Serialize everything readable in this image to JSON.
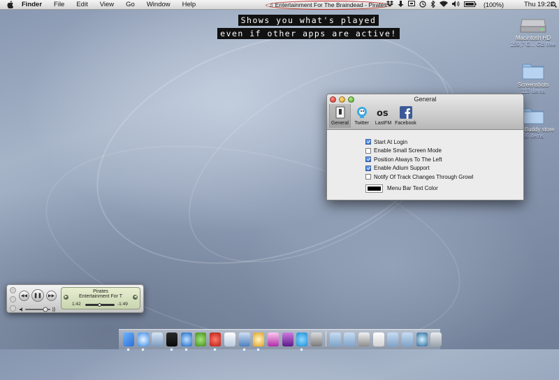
{
  "menubar": {
    "app_name": "Finder",
    "items": [
      "File",
      "Edit",
      "View",
      "Go",
      "Window",
      "Help"
    ],
    "now_playing": "♫ Entertainment For The Braindead - Pirates",
    "battery": "(100%)",
    "clock": "Thu 19:22"
  },
  "caption": {
    "line1": "Shows you what's played",
    "line2": "even if other apps are active!"
  },
  "desktop": {
    "hd": {
      "label": "Macintosh HD",
      "sub": "159,7 G... GB free"
    },
    "screenshots": {
      "label": "Screenshots",
      "sub": "113 items"
    },
    "store": {
      "label": "...ne-Buddy store",
      "sub": "66 items"
    }
  },
  "prefs": {
    "title": "General",
    "tabs": [
      "General",
      "Twitter",
      "LastFM",
      "Facebook"
    ],
    "options": [
      {
        "label": "Start At Login",
        "checked": true
      },
      {
        "label": "Enable Small Screen Mode",
        "checked": false
      },
      {
        "label": "Position Always To The Left",
        "checked": true
      },
      {
        "label": "Enable Adium Support",
        "checked": true
      },
      {
        "label": "Notify Of Track Changes Through Growl",
        "checked": false
      }
    ],
    "color_label": "Menu Bar Text Color",
    "color_value": "#000000"
  },
  "mini_player": {
    "title": "Pirates",
    "artist": "Entertainment For T",
    "elapsed": "1:42",
    "remaining": "-1:49",
    "progress": 0.48
  },
  "dock": {
    "apps": [
      "finder-icon",
      "safari-icon",
      "mail-icon",
      "terminal-icon",
      "itunes-icon",
      "adium-icon",
      "growl-icon",
      "preview-icon",
      "xcode-icon",
      "ichat-icon",
      "stickies-icon",
      "photo-icon",
      "skype-icon",
      "app-icon"
    ],
    "running": [
      0,
      1,
      3,
      4,
      6,
      8,
      9,
      12
    ],
    "stack_items": [
      "applications-folder-icon",
      "documents-folder-icon",
      "printer-icon",
      "file-icon",
      "downloads-folder-icon",
      "pictures-folder-icon",
      "timemachine-icon",
      "trash-icon"
    ]
  }
}
